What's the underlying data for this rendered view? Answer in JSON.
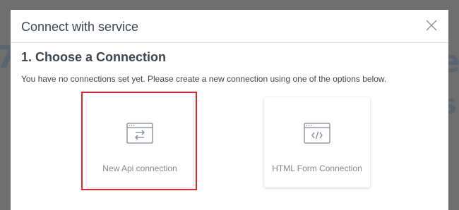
{
  "backdrop": {
    "left_fragment": "7",
    "right_fragment_1": "e",
    "right_fragment_2": "s"
  },
  "modal": {
    "title": "Connect with service",
    "close_icon": "close-icon",
    "section_title": "1. Choose a Connection",
    "hint": "You have no connections set yet. Please create a new connection using one of the options below.",
    "options": [
      {
        "label": "New Api connection",
        "icon": "api-exchange-icon",
        "highlighted": true
      },
      {
        "label": "HTML Form Connection",
        "icon": "code-window-icon",
        "highlighted": false
      }
    ]
  },
  "colors": {
    "overlay": "#6f6f6f",
    "title_text": "#3c4650",
    "muted_text": "#7f8893",
    "icon_stroke": "#7f8893",
    "highlight": "#e0262b"
  }
}
